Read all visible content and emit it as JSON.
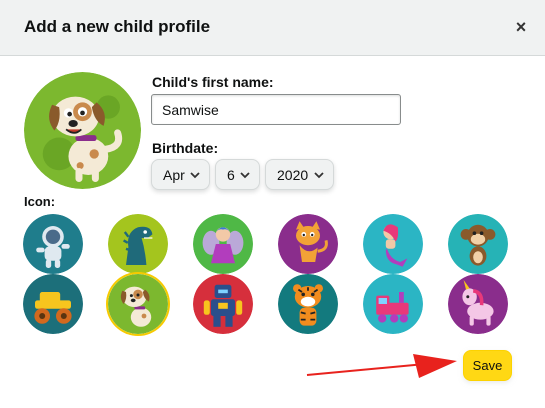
{
  "dialog": {
    "title": "Add a new child profile",
    "close_glyph": "×"
  },
  "form": {
    "name_label": "Child's first name:",
    "name_value": "Samwise",
    "birthdate_label": "Birthdate:",
    "month": "Apr",
    "day": "6",
    "year": "2020",
    "icon_label": "Icon:"
  },
  "avatar": {
    "icon": "puppy-icon",
    "bg": "#7cb82f"
  },
  "icons": [
    {
      "name": "astronaut-icon",
      "bg": "#1f7d8c",
      "selected": false
    },
    {
      "name": "dinosaur-icon",
      "bg": "#a4c51e",
      "selected": false
    },
    {
      "name": "fairy-icon",
      "bg": "#4fb846",
      "selected": false
    },
    {
      "name": "cat-icon",
      "bg": "#8a2d8c",
      "selected": false
    },
    {
      "name": "mermaid-icon",
      "bg": "#2bb5c4",
      "selected": false
    },
    {
      "name": "monkey-icon",
      "bg": "#26b3b6",
      "selected": false
    },
    {
      "name": "monster-truck-icon",
      "bg": "#1c6f7a",
      "selected": false
    },
    {
      "name": "puppy-icon",
      "bg": "#7cb82f",
      "selected": true
    },
    {
      "name": "robot-icon",
      "bg": "#d62f3c",
      "selected": false
    },
    {
      "name": "tiger-icon",
      "bg": "#137a7e",
      "selected": false
    },
    {
      "name": "train-icon",
      "bg": "#2bb5c4",
      "selected": false
    },
    {
      "name": "unicorn-icon",
      "bg": "#8a2d8c",
      "selected": false
    }
  ],
  "save_label": "Save",
  "colors": {
    "accent": "#ffd814",
    "arrow": "#e8221d",
    "header_bg": "#f0f2f2"
  }
}
